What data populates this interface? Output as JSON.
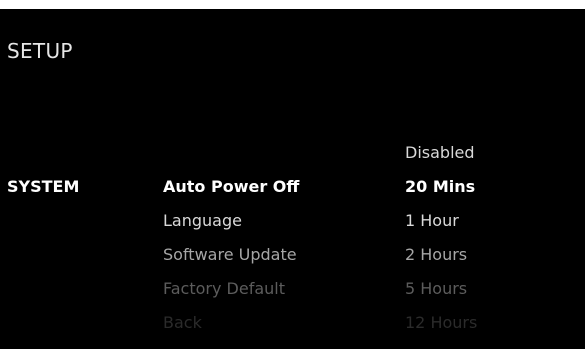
{
  "header": {
    "title": "SETUP"
  },
  "sidebar": {
    "category": "SYSTEM"
  },
  "menu": {
    "items": [
      {
        "label": "Auto Power Off",
        "color": "#ffffff",
        "selected": true
      },
      {
        "label": "Language",
        "color": "#d9d9d9",
        "selected": false
      },
      {
        "label": "Software Update",
        "color": "#a6a6a6",
        "selected": false
      },
      {
        "label": "Factory Default",
        "color": "#5c5c5c",
        "selected": false
      },
      {
        "label": "Back",
        "color": "#2b2b2b",
        "selected": false
      }
    ]
  },
  "options": {
    "items": [
      {
        "label": "Disabled",
        "color": "#d9d9d9",
        "selected": false
      },
      {
        "label": "20 Mins",
        "color": "#ffffff",
        "selected": true
      },
      {
        "label": "1 Hour",
        "color": "#d9d9d9",
        "selected": false
      },
      {
        "label": "2 Hours",
        "color": "#a6a6a6",
        "selected": false
      },
      {
        "label": "5 Hours",
        "color": "#5c5c5c",
        "selected": false
      },
      {
        "label": "12 Hours",
        "color": "#2b2b2b",
        "selected": false
      }
    ]
  },
  "colors": {
    "background": "#000000",
    "title": "#e6e6e6",
    "accent": "#ffffff"
  }
}
